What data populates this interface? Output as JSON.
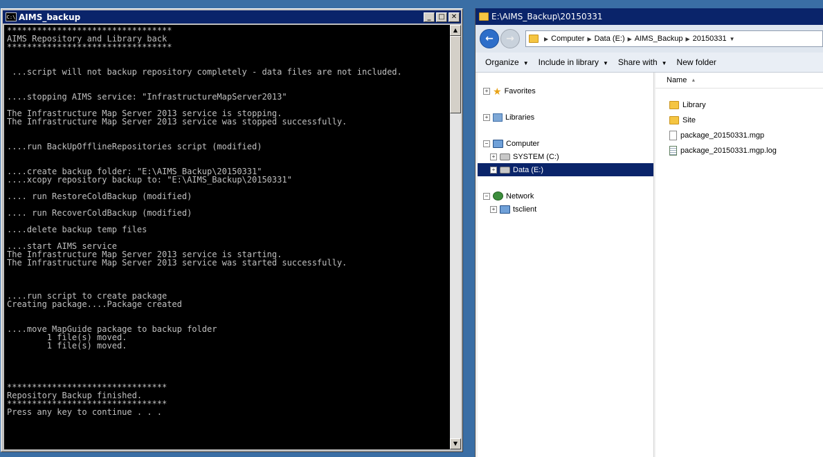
{
  "console": {
    "title": "AIMS_backup",
    "lines": [
      "*********************************",
      "AIMS Repository and Library back",
      "*********************************",
      "",
      "",
      " ...script will not backup repository completely - data files are not included.",
      "",
      "",
      "....stopping AIMS service: \"InfrastructureMapServer2013\"",
      "",
      "The Infrastructure Map Server 2013 service is stopping.",
      "The Infrastructure Map Server 2013 service was stopped successfully.",
      "",
      "",
      "....run BackUpOfflineRepositories script (modified)",
      "",
      "",
      "....create backup folder: \"E:\\AIMS_Backup\\20150331\"",
      "....xcopy repository backup to: \"E:\\AIMS_Backup\\20150331\"",
      "",
      ".... run RestoreColdBackup (modified)",
      "",
      ".... run RecoverColdBackup (modified)",
      "",
      "....delete backup temp files",
      "",
      "....start AIMS service",
      "The Infrastructure Map Server 2013 service is starting.",
      "The Infrastructure Map Server 2013 service was started successfully.",
      "",
      "",
      "",
      "....run script to create package",
      "Creating package....Package created",
      "",
      "",
      "....move MapGuide package to backup folder",
      "        1 file(s) moved.",
      "        1 file(s) moved.",
      "",
      "",
      "",
      "",
      "********************************",
      "Repository Backup finished.",
      "********************************",
      "Press any key to continue . . ."
    ]
  },
  "explorer": {
    "title": "E:\\AIMS_Backup\\20150331",
    "address": [
      "Computer",
      "Data (E:)",
      "AIMS_Backup",
      "20150331"
    ],
    "toolbar": {
      "organize": "Organize",
      "include": "Include in library",
      "share": "Share with",
      "new_folder": "New folder"
    },
    "nav": {
      "favorites": "Favorites",
      "libraries": "Libraries",
      "computer": "Computer",
      "system_c": "SYSTEM (C:)",
      "data_e": "Data (E:)",
      "network": "Network",
      "tsclient": "tsclient"
    },
    "column_name": "Name",
    "files": [
      "Library",
      "Site",
      "package_20150331.mgp",
      "package_20150331.mgp.log"
    ]
  },
  "colors": {
    "desktop": "#3a6ea5",
    "titlebar": "#0a246a",
    "console_bg": "#000000",
    "console_text": "#c0c0c0",
    "selection": "#0a246a"
  }
}
